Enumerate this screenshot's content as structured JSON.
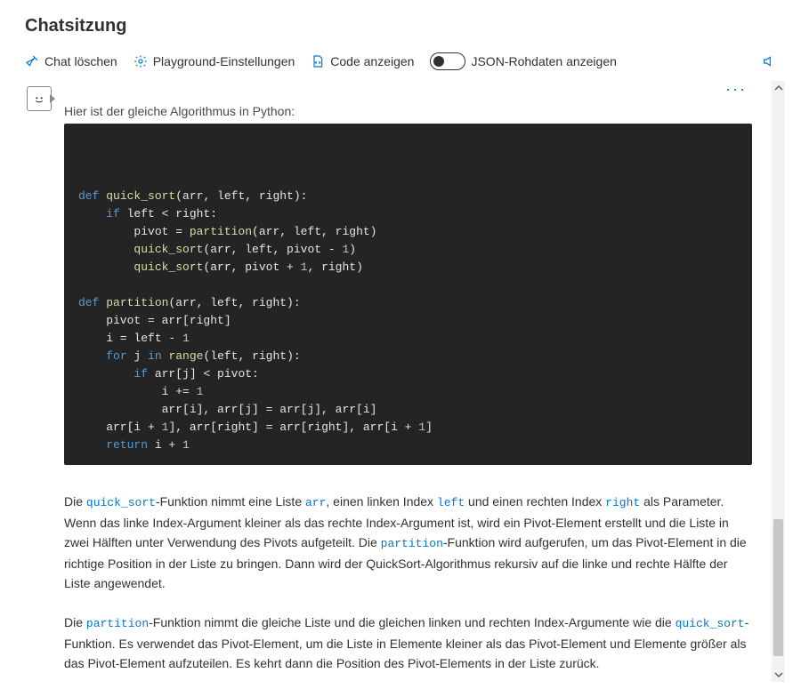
{
  "title": "Chatsitzung",
  "toolbar": {
    "clear_chat": "Chat löschen",
    "playground_settings": "Playground-Einstellungen",
    "show_code": "Code anzeigen",
    "show_raw_json": "JSON-Rohdaten anzeigen",
    "raw_json_toggle_on": false
  },
  "message": {
    "intro": "Hier ist der gleiche Algorithmus in Python:",
    "code_language": "python",
    "code_tokens": [
      [
        [
          "kw",
          "def"
        ],
        [
          "id",
          " "
        ],
        [
          "fn",
          "quick_sort"
        ],
        [
          "id",
          "(arr, left, right):"
        ]
      ],
      [
        [
          "id",
          "    "
        ],
        [
          "kw",
          "if"
        ],
        [
          "id",
          " left < right:"
        ]
      ],
      [
        [
          "id",
          "        pivot = "
        ],
        [
          "fn",
          "partition"
        ],
        [
          "id",
          "(arr, left, right)"
        ]
      ],
      [
        [
          "id",
          "        "
        ],
        [
          "fn",
          "quick_sort"
        ],
        [
          "id",
          "(arr, left, pivot - "
        ],
        [
          "num",
          "1"
        ],
        [
          "id",
          ")"
        ]
      ],
      [
        [
          "id",
          "        "
        ],
        [
          "fn",
          "quick_sort"
        ],
        [
          "id",
          "(arr, pivot + "
        ],
        [
          "num",
          "1"
        ],
        [
          "id",
          ", right)"
        ]
      ],
      [
        [
          "id",
          ""
        ]
      ],
      [
        [
          "kw",
          "def"
        ],
        [
          "id",
          " "
        ],
        [
          "fn",
          "partition"
        ],
        [
          "id",
          "(arr, left, right):"
        ]
      ],
      [
        [
          "id",
          "    pivot = arr[right]"
        ]
      ],
      [
        [
          "id",
          "    i = left - "
        ],
        [
          "num",
          "1"
        ]
      ],
      [
        [
          "id",
          "    "
        ],
        [
          "kw",
          "for"
        ],
        [
          "id",
          " j "
        ],
        [
          "kw",
          "in"
        ],
        [
          "id",
          " "
        ],
        [
          "fn",
          "range"
        ],
        [
          "id",
          "(left, right):"
        ]
      ],
      [
        [
          "id",
          "        "
        ],
        [
          "kw",
          "if"
        ],
        [
          "id",
          " arr[j] < pivot:"
        ]
      ],
      [
        [
          "id",
          "            i += "
        ],
        [
          "num",
          "1"
        ]
      ],
      [
        [
          "id",
          "            arr[i], arr[j] = arr[j], arr[i]"
        ]
      ],
      [
        [
          "id",
          "    arr[i + "
        ],
        [
          "num",
          "1"
        ],
        [
          "id",
          "], arr[right] = arr[right], arr[i + "
        ],
        [
          "num",
          "1"
        ],
        [
          "id",
          "]"
        ]
      ],
      [
        [
          "id",
          "    "
        ],
        [
          "kw",
          "return"
        ],
        [
          "id",
          " i + "
        ],
        [
          "num",
          "1"
        ]
      ]
    ],
    "para1_runs": [
      [
        "text",
        "Die "
      ],
      [
        "code",
        "quick_sort"
      ],
      [
        "text",
        "-Funktion nimmt eine Liste "
      ],
      [
        "code",
        "arr"
      ],
      [
        "text",
        ", einen linken Index "
      ],
      [
        "code",
        "left"
      ],
      [
        "text",
        " und einen rechten Index "
      ],
      [
        "code",
        "right"
      ],
      [
        "text",
        " als Parameter. Wenn das linke Index-Argument kleiner als das rechte Index-Argument ist, wird ein Pivot-Element erstellt und die Liste in zwei Hälften unter Verwendung des Pivots aufgeteilt. Die "
      ],
      [
        "code",
        "partition"
      ],
      [
        "text",
        "-Funktion wird aufgerufen, um das Pivot-Element in die richtige Position in der Liste zu bringen. Dann wird der QuickSort-Algorithmus rekursiv auf die linke und rechte Hälfte der Liste angewendet."
      ]
    ],
    "para2_runs": [
      [
        "text",
        "Die "
      ],
      [
        "code",
        "partition"
      ],
      [
        "text",
        "-Funktion nimmt die gleiche Liste und die gleichen linken und rechten Index-Argumente wie die "
      ],
      [
        "code",
        "quick_sort"
      ],
      [
        "text",
        "-Funktion. Es verwendet das Pivot-Element, um die Liste in Elemente kleiner als das Pivot-Element und Elemente größer als das Pivot-Element aufzuteilen. Es kehrt dann die Position des Pivot-Elements in der Liste zurück."
      ]
    ]
  },
  "scrollbar": {
    "thumb_top_pct": 74,
    "thumb_height_pct": 24
  }
}
